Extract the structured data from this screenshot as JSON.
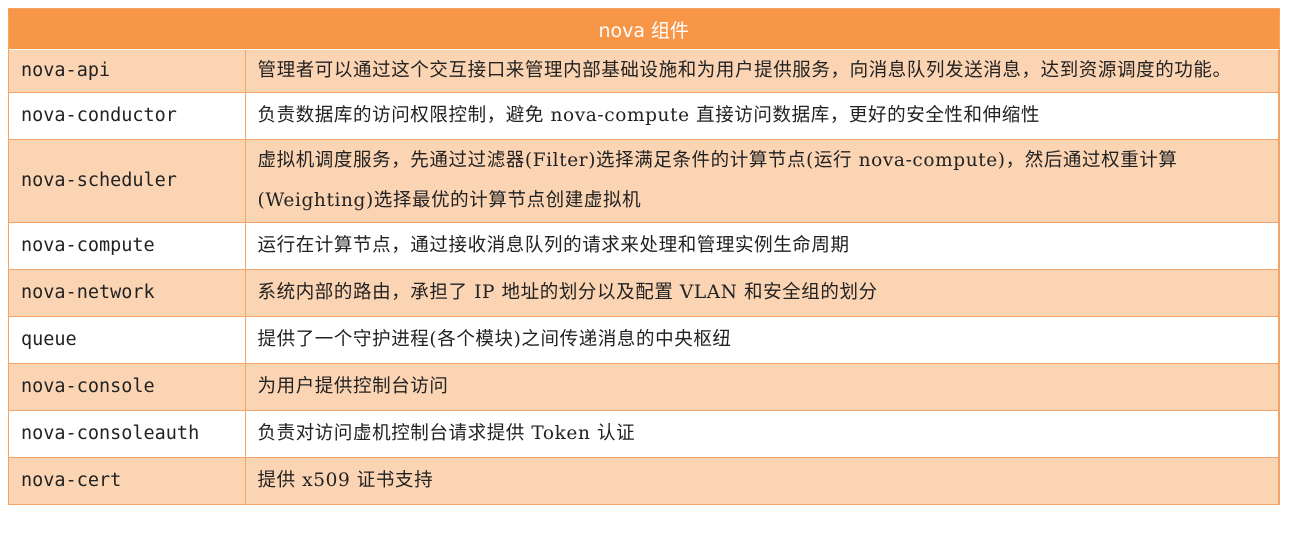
{
  "table": {
    "title": "nova 组件",
    "header_color": "#f79646",
    "odd_row_color": "#fbd4b4",
    "even_row_color": "#ffffff",
    "rows": [
      {
        "name": "nova-api",
        "desc": "管理者可以通过这个交互接口来管理内部基础设施和为用户提供服务，向消息队列发送消息，达到资源调度的功能。"
      },
      {
        "name": "nova-conductor",
        "desc": "负责数据库的访问权限控制，避免 nova-compute 直接访问数据库，更好的安全性和伸缩性"
      },
      {
        "name": "nova-scheduler",
        "desc": "虚拟机调度服务，先通过过滤器(Filter)选择满足条件的计算节点(运行 nova-compute)，然后通过权重计算(Weighting)选择最优的计算节点创建虚拟机"
      },
      {
        "name": "nova-compute",
        "desc": "运行在计算节点，通过接收消息队列的请求来处理和管理实例生命周期"
      },
      {
        "name": "nova-network",
        "desc": "系统内部的路由，承担了 IP 地址的划分以及配置 VLAN 和安全组的划分"
      },
      {
        "name": "queue",
        "desc": "提供了一个守护进程(各个模块)之间传递消息的中央枢纽"
      },
      {
        "name": "nova-console",
        "desc": "为用户提供控制台访问"
      },
      {
        "name": "nova-consoleauth",
        "desc": "负责对访问虚机控制台请求提供 Token 认证"
      },
      {
        "name": "nova-cert",
        "desc": "提供 x509 证书支持"
      }
    ]
  }
}
